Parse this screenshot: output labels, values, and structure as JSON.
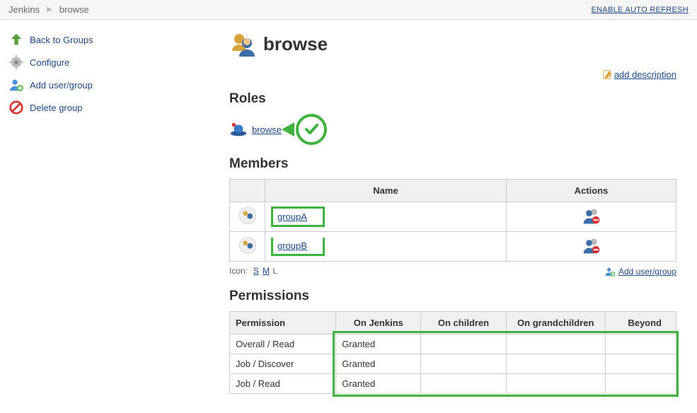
{
  "breadcrumbs": {
    "jenkins": "Jenkins",
    "current": "browse"
  },
  "auto_refresh": "ENABLE AUTO REFRESH",
  "sidebar": {
    "back": "Back to Groups",
    "configure": "Configure",
    "add": "Add user/group",
    "delete": "Delete group"
  },
  "page": {
    "title": "browse",
    "add_description": "add description"
  },
  "roles": {
    "heading": "Roles",
    "item": "browse"
  },
  "members": {
    "heading": "Members",
    "col_name": "Name",
    "col_actions": "Actions",
    "rows": [
      {
        "name": "groupA"
      },
      {
        "name": "groupB"
      }
    ]
  },
  "icon_sizes": {
    "label": "Icon:",
    "s": "S",
    "m": "M",
    "l": "L"
  },
  "add_user_group": "Add user/group",
  "permissions": {
    "heading": "Permissions",
    "cols": {
      "perm": "Permission",
      "jenkins": "On Jenkins",
      "children": "On children",
      "grand": "On grandchildren",
      "beyond": "Beyond"
    },
    "rows": [
      {
        "name": "Overall / Read",
        "jenkins": "Granted",
        "children": "",
        "grand": "",
        "beyond": ""
      },
      {
        "name": "Job / Discover",
        "jenkins": "Granted",
        "children": "",
        "grand": "",
        "beyond": ""
      },
      {
        "name": "Job / Read",
        "jenkins": "Granted",
        "children": "",
        "grand": "",
        "beyond": ""
      }
    ]
  }
}
